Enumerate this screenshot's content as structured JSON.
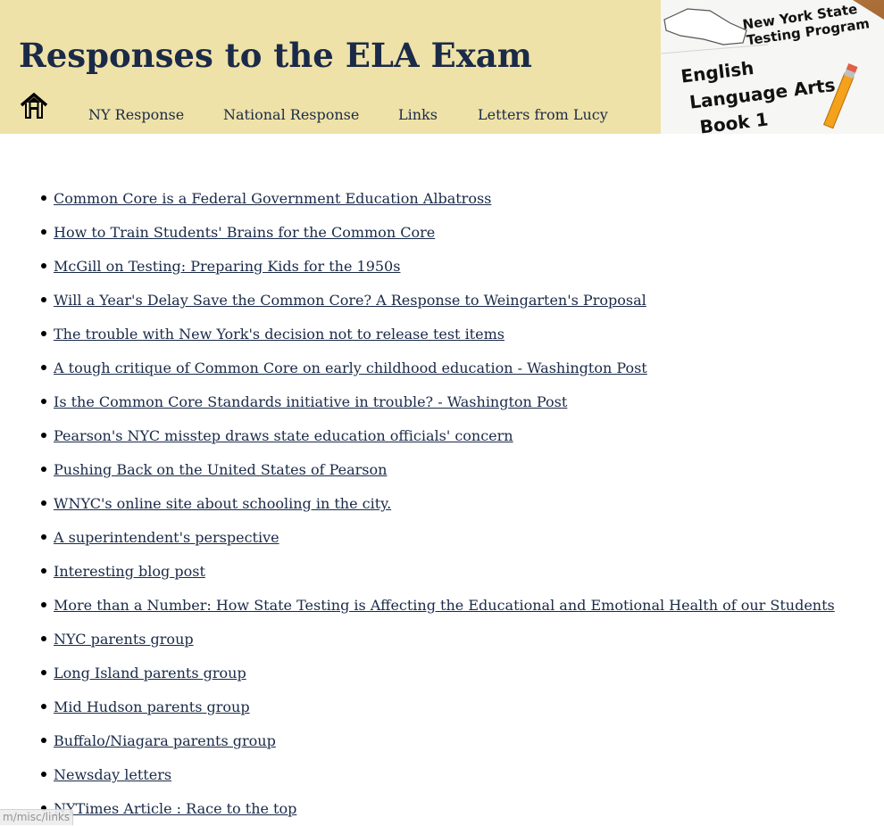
{
  "header": {
    "title": "Responses to the ELA Exam",
    "home_icon": "house-icon",
    "nav": [
      {
        "label": "NY Response"
      },
      {
        "label": "National Response"
      },
      {
        "label": "Links"
      },
      {
        "label": "Letters from Lucy"
      }
    ]
  },
  "banner": {
    "line1": "New York State",
    "line2": "Testing Program",
    "line3": "English",
    "line4": "Language Arts",
    "line5": "Book 1"
  },
  "links": [
    "Common Core is a Federal Government Education Albatross",
    "How to Train Students' Brains for the Common Core",
    "McGill on Testing: Preparing Kids for the 1950s",
    "Will a Year's Delay Save the Common Core? A Response to Weingarten's Proposal",
    "The trouble with New York's decision not to release test items",
    "A tough critique of Common Core on early childhood education - Washington Post",
    "Is the Common Core Standards initiative in trouble? - Washington Post",
    "Pearson's NYC misstep draws state education officials' concern",
    "Pushing Back on the United States of Pearson",
    "WNYC's online site about schooling in the city.",
    "A superintendent's perspective",
    "Interesting blog post",
    "More than a Number: How State Testing is Affecting the Educational and Emotional Health of our Students",
    "NYC parents group",
    "Long Island parents group",
    "Mid Hudson parents group",
    "Buffalo/Niagara parents group",
    "Newsday letters",
    "NYTimes Article : Race to the top"
  ],
  "status_bar": {
    "url": "m/misc/links"
  },
  "colors": {
    "header_bg": "#efe2a8",
    "text": "#1a2a48"
  }
}
